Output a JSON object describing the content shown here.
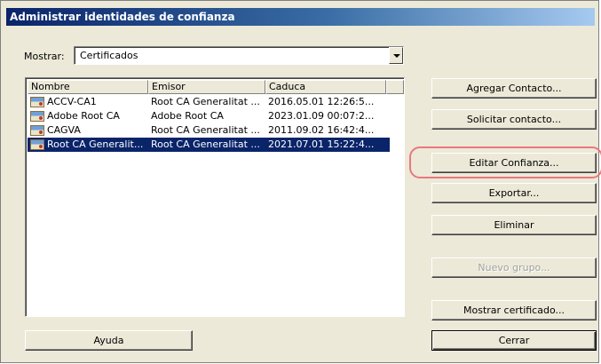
{
  "window": {
    "title": "Administrar identidades de confianza"
  },
  "filter": {
    "label": "Mostrar:",
    "selected": "Certificados"
  },
  "list": {
    "columns": [
      "Nombre",
      "Emisor",
      "Caduca"
    ],
    "rows": [
      {
        "name": "ACCV-CA1",
        "issuer": "Root CA Generalitat ...",
        "expires": "2016.05.01 12:26:5..."
      },
      {
        "name": "Adobe Root CA",
        "issuer": "Adobe Root CA",
        "expires": "2023.01.09 00:07:2..."
      },
      {
        "name": "CAGVA",
        "issuer": "Root CA Generalitat ...",
        "expires": "2011.09.02 16:42:4..."
      },
      {
        "name": "Root CA Generalit...",
        "issuer": "Root CA Generalitat ...",
        "expires": "2021.07.01 15:22:4..."
      }
    ],
    "selected_row_index": 3
  },
  "buttons": {
    "add_contact": "Agregar Contacto...",
    "request_contact": "Solicitar contacto...",
    "edit_trust": "Editar Confianza...",
    "export": "Exportar...",
    "delete": "Eliminar",
    "new_group": "Nuevo grupo...",
    "show_certificate": "Mostrar certificado...",
    "help": "Ayuda",
    "close": "Cerrar"
  },
  "colors": {
    "selection": "#0a246a",
    "highlight_ring": "#e8787d",
    "dialog_bg": "#ece9d8"
  },
  "icons": {
    "row_icon": "certificate-icon",
    "combo_arrow": "chevron-down-icon"
  }
}
